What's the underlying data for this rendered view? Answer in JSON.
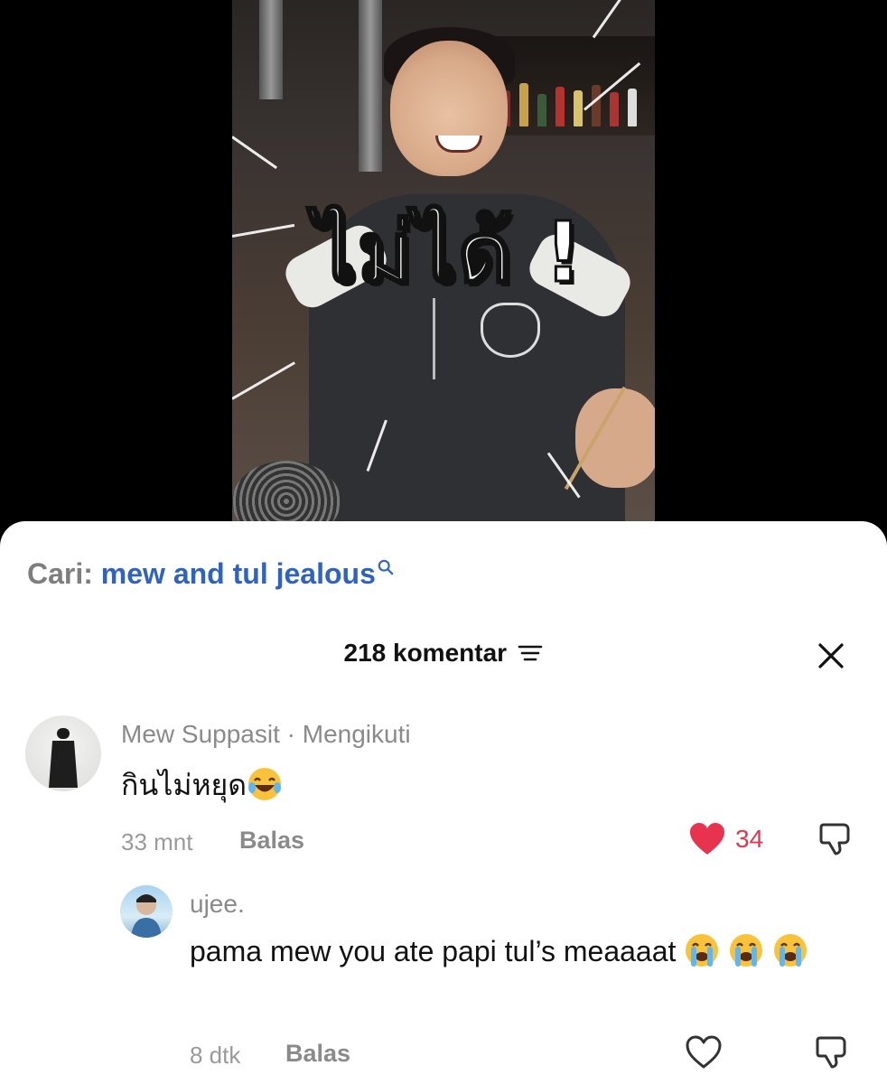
{
  "video": {
    "overlay_caption": "ไม่ได้ !"
  },
  "search": {
    "prefix": "Cari:",
    "term": "mew and tul jealous"
  },
  "header": {
    "count_label": "218 komentar"
  },
  "comments": [
    {
      "author": "Mew Suppasit",
      "separator": "·",
      "follow_status": "Mengikuti",
      "text": "กินไม่หยุด",
      "emojis": [
        "laughing-tears-emoji"
      ],
      "time": "33 mnt",
      "reply_label": "Balas",
      "likes": "34",
      "liked": true
    },
    {
      "author": "ujee.",
      "text": "pama mew you ate papi tul’s meaaaat",
      "emojis": [
        "crying-emoji",
        "crying-emoji",
        "crying-emoji"
      ],
      "time": "8 dtk",
      "reply_label": "Balas",
      "liked": false
    }
  ],
  "colors": {
    "link_blue": "#2f63c2",
    "like_red": "#e8334f",
    "muted": "#8a8a8a"
  }
}
